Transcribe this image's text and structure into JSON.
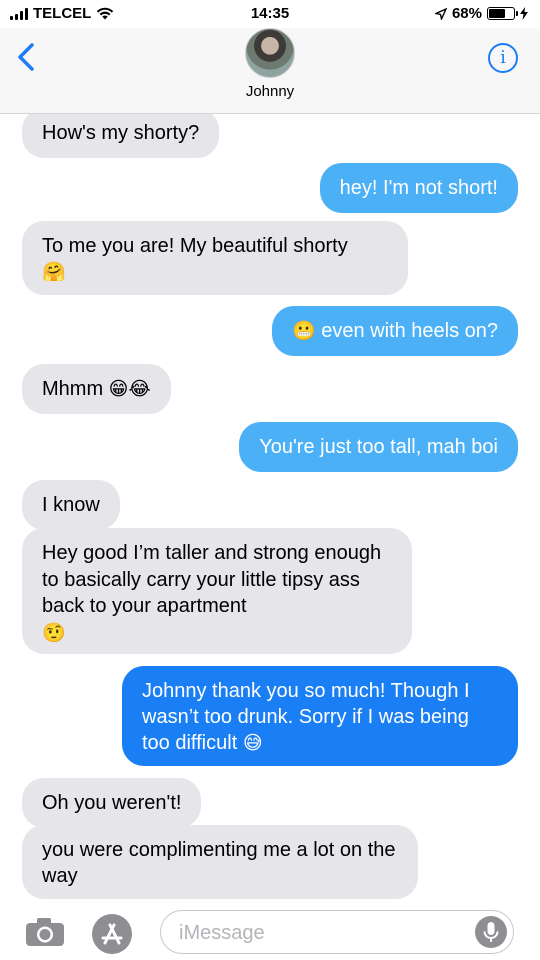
{
  "status_bar": {
    "carrier": "TELCEL",
    "time": "14:35",
    "battery_percent_label": "68%",
    "battery_level": 0.68
  },
  "header": {
    "contact_name": "Johnny",
    "back_icon": "chevron-left-icon",
    "info_icon": "info-icon",
    "info_symbol": "i"
  },
  "messages": [
    {
      "direction": "in",
      "text": "How's my shorty?"
    },
    {
      "direction": "out",
      "text": "hey! I'm not short!"
    },
    {
      "direction": "in",
      "text": "To me you are! My beautiful shorty",
      "emoji": "🤗"
    },
    {
      "direction": "out",
      "emoji_prefix": "😬",
      "text": " even with heels on?"
    },
    {
      "direction": "in",
      "text": "Mhmm ",
      "emoji": "😁😂"
    },
    {
      "direction": "out",
      "text": "You're just too tall, mah boi"
    },
    {
      "direction": "in",
      "text": "I know"
    },
    {
      "direction": "in",
      "text": "Hey good I’m taller and strong enough to basically carry your little tipsy ass back to your apartment",
      "emoji": "🤨"
    },
    {
      "direction": "out",
      "text": "Johnny thank you so much! Though I wasn’t too drunk. Sorry if I was being too difficult ",
      "emoji": "😅"
    },
    {
      "direction": "in",
      "text": "Oh you weren't!"
    },
    {
      "direction": "in",
      "text": "you were complimenting me a lot on the way"
    }
  ],
  "input_bar": {
    "placeholder": "iMessage",
    "camera_icon": "camera-icon",
    "apps_icon": "app-store-icon",
    "mic_icon": "microphone-icon"
  },
  "colors": {
    "incoming_bubble": "#e5e5ea",
    "outgoing_bubble_sms_like": "#4bb0f5",
    "outgoing_bubble_imessage": "#1a7ef5",
    "accent": "#1e7cf8"
  }
}
